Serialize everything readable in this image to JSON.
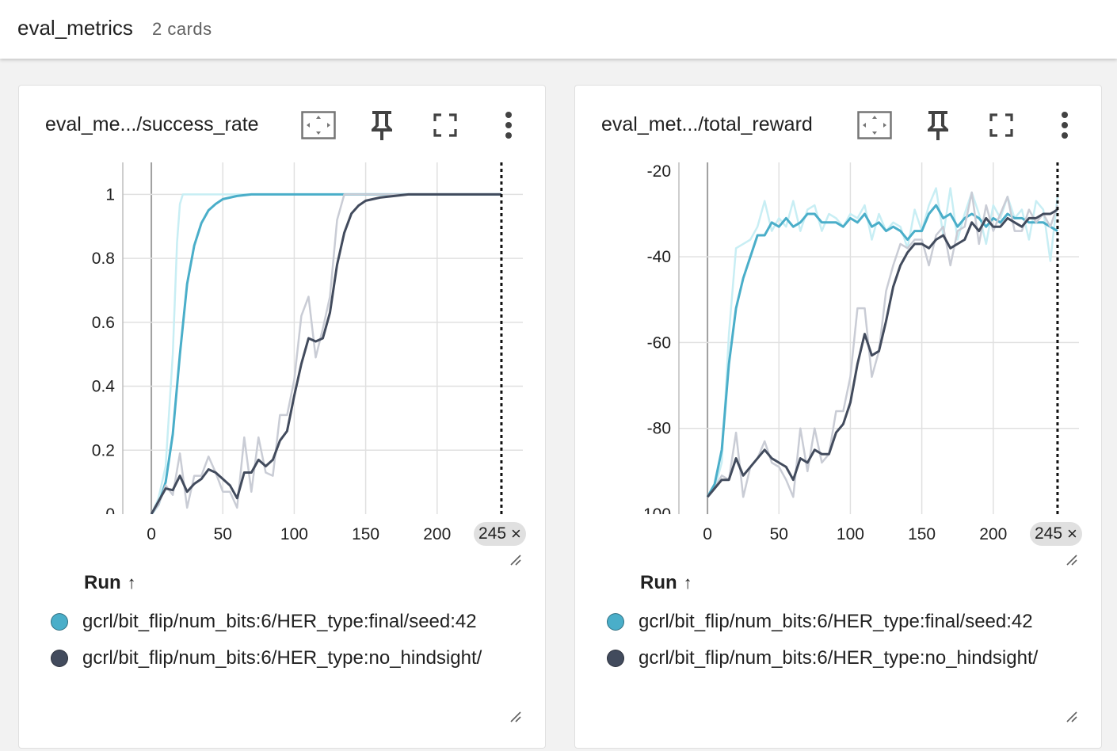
{
  "group": {
    "title": "eval_metrics",
    "count": "2 cards"
  },
  "colors": {
    "run_final": "#4aaec9",
    "run_final_light": "#c8eef4",
    "run_no_hindsight": "#424b5d",
    "run_no_hindsight_light": "#c9ccd5"
  },
  "icons": {
    "fit": "fit-to-data-icon",
    "pin": "pin-icon",
    "fullscreen": "fullscreen-icon",
    "more": "more-vert-icon",
    "close": "close-icon",
    "resize": "resize-handle-icon"
  },
  "cards": [
    {
      "title": "eval_me.../success_rate",
      "run_header": "Run",
      "sort_arrow": "↑",
      "step_chip": {
        "label": "245",
        "close": "×"
      },
      "runs": [
        {
          "name": "gcrl/bit_flip/num_bits:6/HER_type:final/seed:42",
          "color": "#4aaec9"
        },
        {
          "name": "gcrl/bit_flip/num_bits:6/HER_type:no_hindsight/",
          "color": "#424b5d"
        }
      ]
    },
    {
      "title": "eval_met.../total_reward",
      "run_header": "Run",
      "sort_arrow": "↑",
      "step_chip": {
        "label": "245",
        "close": "×"
      },
      "runs": [
        {
          "name": "gcrl/bit_flip/num_bits:6/HER_type:final/seed:42",
          "color": "#4aaec9"
        },
        {
          "name": "gcrl/bit_flip/num_bits:6/HER_type:no_hindsight/",
          "color": "#424b5d"
        }
      ]
    }
  ],
  "chart_data": [
    {
      "type": "line",
      "xlim": [
        -20,
        260
      ],
      "ylim": [
        0,
        1.1
      ],
      "x_ticks": [
        0,
        50,
        100,
        150,
        200
      ],
      "y_ticks": [
        0.2,
        0.4,
        0.6,
        0.8,
        1
      ],
      "y_tick_labels": [
        "0.2",
        "0.4",
        "0.6",
        "0.8",
        "1"
      ],
      "x_tick_labels": [
        "0",
        "50",
        "100",
        "150",
        "200"
      ],
      "cutoff_y_label": "0",
      "grid": true,
      "step_marker": 245,
      "series": [
        {
          "role": "final_raw",
          "x": [
            0,
            5,
            10,
            15,
            18,
            20,
            22,
            25,
            30,
            40,
            60,
            100,
            130,
            200,
            245
          ],
          "y": [
            0,
            0.05,
            0.15,
            0.5,
            0.85,
            0.97,
            1,
            1,
            1,
            1,
            1,
            1,
            1,
            1,
            1
          ]
        },
        {
          "role": "final_smooth",
          "x": [
            0,
            5,
            10,
            15,
            20,
            25,
            30,
            35,
            40,
            45,
            50,
            60,
            70,
            80,
            100,
            150,
            200,
            245
          ],
          "y": [
            0,
            0.03,
            0.1,
            0.25,
            0.5,
            0.72,
            0.84,
            0.91,
            0.95,
            0.97,
            0.985,
            0.995,
            1,
            1,
            1,
            1,
            1,
            1
          ]
        },
        {
          "role": "nohind_raw",
          "x": [
            0,
            5,
            10,
            15,
            20,
            25,
            30,
            35,
            40,
            45,
            50,
            55,
            60,
            65,
            70,
            75,
            80,
            85,
            90,
            95,
            100,
            105,
            110,
            115,
            120,
            125,
            130,
            135,
            140,
            150,
            200,
            245
          ],
          "y": [
            0,
            0.03,
            0.09,
            0.06,
            0.19,
            0.02,
            0.12,
            0.12,
            0.18,
            0.13,
            0.07,
            0.07,
            0.02,
            0.24,
            0.07,
            0.24,
            0.13,
            0.12,
            0.31,
            0.31,
            0.42,
            0.62,
            0.68,
            0.49,
            0.58,
            0.68,
            0.92,
            1,
            1,
            1,
            1,
            1
          ]
        },
        {
          "role": "nohind_smooth",
          "x": [
            0,
            5,
            10,
            15,
            20,
            25,
            30,
            35,
            40,
            45,
            50,
            55,
            60,
            65,
            70,
            75,
            80,
            85,
            90,
            95,
            100,
            105,
            110,
            115,
            120,
            125,
            130,
            135,
            140,
            145,
            150,
            160,
            170,
            180,
            200,
            245
          ],
          "y": [
            0,
            0.04,
            0.08,
            0.075,
            0.12,
            0.07,
            0.095,
            0.11,
            0.14,
            0.13,
            0.11,
            0.09,
            0.05,
            0.13,
            0.13,
            0.17,
            0.15,
            0.17,
            0.23,
            0.26,
            0.37,
            0.47,
            0.55,
            0.54,
            0.55,
            0.63,
            0.78,
            0.88,
            0.94,
            0.965,
            0.98,
            0.99,
            0.995,
            1,
            1,
            1
          ]
        }
      ]
    },
    {
      "type": "line",
      "xlim": [
        -20,
        260
      ],
      "ylim": [
        -100,
        -18
      ],
      "x_ticks": [
        0,
        50,
        100,
        150,
        200
      ],
      "y_ticks": [
        -80,
        -60,
        -40
      ],
      "y_tick_labels": [
        "-80",
        "-60",
        "-40"
      ],
      "x_tick_labels": [
        "0",
        "50",
        "100",
        "150",
        "200"
      ],
      "cutoff_top_label": "-20",
      "cutoff_bottom_label": "-100",
      "grid": true,
      "step_marker": 245,
      "series": [
        {
          "role": "final_raw",
          "x": [
            0,
            5,
            10,
            15,
            20,
            25,
            30,
            35,
            40,
            45,
            50,
            55,
            60,
            65,
            70,
            75,
            80,
            85,
            90,
            95,
            100,
            105,
            110,
            115,
            120,
            125,
            130,
            135,
            140,
            145,
            150,
            155,
            160,
            165,
            170,
            175,
            180,
            185,
            190,
            195,
            200,
            205,
            210,
            215,
            220,
            225,
            230,
            235,
            240,
            245
          ],
          "y": [
            -96,
            -94,
            -88,
            -58,
            -38,
            -37,
            -36,
            -33,
            -27,
            -34,
            -31,
            -33,
            -27,
            -34,
            -29,
            -28,
            -34,
            -30,
            -31,
            -33,
            -30,
            -31,
            -28,
            -36,
            -30,
            -34,
            -32,
            -33,
            -38,
            -29,
            -34,
            -28,
            -24,
            -35,
            -24,
            -36,
            -30,
            -25,
            -30,
            -37,
            -28,
            -31,
            -26,
            -31,
            -29,
            -36,
            -27,
            -29,
            -41,
            -26
          ]
        },
        {
          "role": "final_smooth",
          "x": [
            0,
            5,
            10,
            15,
            20,
            25,
            30,
            35,
            40,
            45,
            50,
            55,
            60,
            65,
            70,
            75,
            80,
            85,
            90,
            95,
            100,
            105,
            110,
            115,
            120,
            125,
            130,
            135,
            140,
            145,
            150,
            155,
            160,
            165,
            170,
            175,
            180,
            185,
            190,
            195,
            200,
            205,
            210,
            215,
            220,
            225,
            230,
            235,
            240,
            245
          ],
          "y": [
            -96,
            -93,
            -85,
            -65,
            -52,
            -45,
            -40,
            -35,
            -35,
            -32,
            -33,
            -31,
            -33,
            -32,
            -30,
            -30,
            -32,
            -32,
            -32,
            -33,
            -31,
            -32,
            -30,
            -33,
            -32,
            -34,
            -33,
            -34,
            -36,
            -34,
            -34,
            -30,
            -28,
            -31,
            -30,
            -33,
            -31,
            -30,
            -31,
            -33,
            -31,
            -32,
            -30,
            -31,
            -31,
            -32,
            -32,
            -32,
            -33,
            -34
          ]
        },
        {
          "role": "nohind_raw",
          "x": [
            0,
            5,
            10,
            15,
            20,
            25,
            30,
            35,
            40,
            45,
            50,
            55,
            60,
            65,
            70,
            75,
            80,
            85,
            90,
            95,
            100,
            105,
            110,
            115,
            120,
            125,
            130,
            135,
            140,
            145,
            150,
            155,
            160,
            165,
            170,
            175,
            180,
            185,
            190,
            195,
            200,
            205,
            210,
            215,
            220,
            225,
            230,
            235,
            240,
            245
          ],
          "y": [
            -96,
            -94,
            -91,
            -92,
            -81,
            -96,
            -89,
            -87,
            -83,
            -88,
            -89,
            -92,
            -96,
            -80,
            -90,
            -80,
            -88,
            -86,
            -76,
            -76,
            -68,
            -52,
            -52,
            -68,
            -62,
            -48,
            -42,
            -37,
            -38,
            -36,
            -36,
            -42,
            -35,
            -33,
            -42,
            -34,
            -33,
            -25,
            -37,
            -28,
            -34,
            -30,
            -26,
            -34,
            -34,
            -29,
            -32,
            -30,
            -33,
            -28
          ]
        },
        {
          "role": "nohind_smooth",
          "x": [
            0,
            5,
            10,
            15,
            20,
            25,
            30,
            35,
            40,
            45,
            50,
            55,
            60,
            65,
            70,
            75,
            80,
            85,
            90,
            95,
            100,
            105,
            110,
            115,
            120,
            125,
            130,
            135,
            140,
            145,
            150,
            155,
            160,
            165,
            170,
            175,
            180,
            185,
            190,
            195,
            200,
            205,
            210,
            215,
            220,
            225,
            230,
            235,
            240,
            245
          ],
          "y": [
            -96,
            -94,
            -92,
            -92,
            -87,
            -91,
            -89,
            -87,
            -85,
            -87,
            -88,
            -89,
            -92,
            -87,
            -88,
            -85,
            -86,
            -86,
            -81,
            -79,
            -74,
            -65,
            -58,
            -63,
            -62,
            -55,
            -47,
            -42,
            -39,
            -37,
            -37,
            -38,
            -36,
            -35,
            -38,
            -37,
            -36,
            -32,
            -34,
            -31,
            -33,
            -33,
            -31,
            -32,
            -33,
            -31,
            -31,
            -30,
            -30,
            -29
          ]
        }
      ]
    }
  ]
}
